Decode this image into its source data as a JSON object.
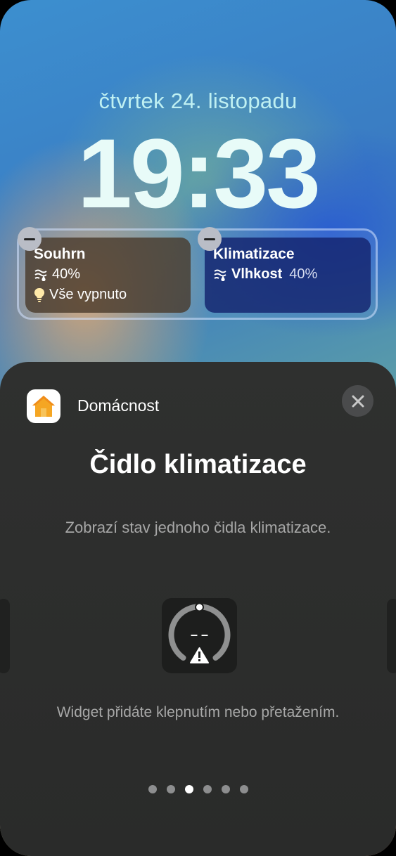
{
  "lockscreen": {
    "date": "čtvrtek 24. listopadu",
    "time": "19:33"
  },
  "widgets": [
    {
      "title": "Souhrn",
      "rows": [
        {
          "icon": "humidity-icon",
          "value": "40%"
        },
        {
          "icon": "lightbulb-icon",
          "value": "Vše vypnuto"
        }
      ]
    },
    {
      "title": "Klimatizace",
      "rows": [
        {
          "icon": "humidity-icon",
          "label": "Vlhkost",
          "value": "40%"
        }
      ]
    }
  ],
  "sheet": {
    "app_name": "Domácnost",
    "app_icon": "home-app-icon",
    "title": "Čidlo klimatizace",
    "description": "Zobrazí stav jednoho čidla klimatizace.",
    "preview_value": "– –",
    "hint": "Widget přidáte klepnutím nebo přetažením.",
    "page_count": 6,
    "active_page": 3
  },
  "colors": {
    "sheet_bg": "#2f302f",
    "date_text": "#bff0f2",
    "home_icon_orange": "#f5a623"
  }
}
